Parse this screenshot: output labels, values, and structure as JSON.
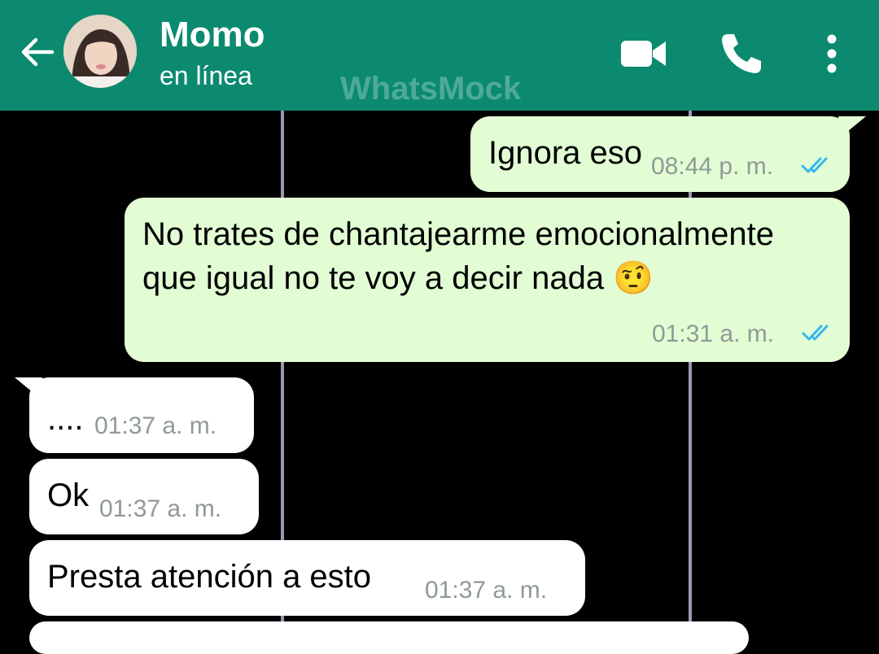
{
  "header": {
    "contact_name": "Momo",
    "status": "en línea",
    "watermark": "WhatsMock",
    "icons": [
      "back-arrow-icon",
      "video-call-icon",
      "phone-icon",
      "more-vert-icon"
    ],
    "colors": {
      "bar": "#0b8a6f",
      "text": "#ffffff"
    }
  },
  "messages": [
    {
      "direction": "outgoing",
      "text": "Ignora eso",
      "time": "08:44 p. m.",
      "read": true
    },
    {
      "direction": "outgoing",
      "text": "No trates de chantajearme emocionalmente que igual no te voy a decir nada 🤨",
      "time": "01:31 a. m.",
      "read": true
    },
    {
      "direction": "incoming",
      "text": "....",
      "time": "01:37 a. m."
    },
    {
      "direction": "incoming",
      "text": "Ok",
      "time": "01:37 a. m."
    },
    {
      "direction": "incoming",
      "text": "Presta atención a esto",
      "time": "01:37 a. m."
    }
  ],
  "colors": {
    "outgoing_bubble": "#e2fdd4",
    "incoming_bubble": "#ffffff",
    "read_ticks": "#34b7f1",
    "timestamp": "#8f9a96",
    "chat_background": "#000000"
  }
}
